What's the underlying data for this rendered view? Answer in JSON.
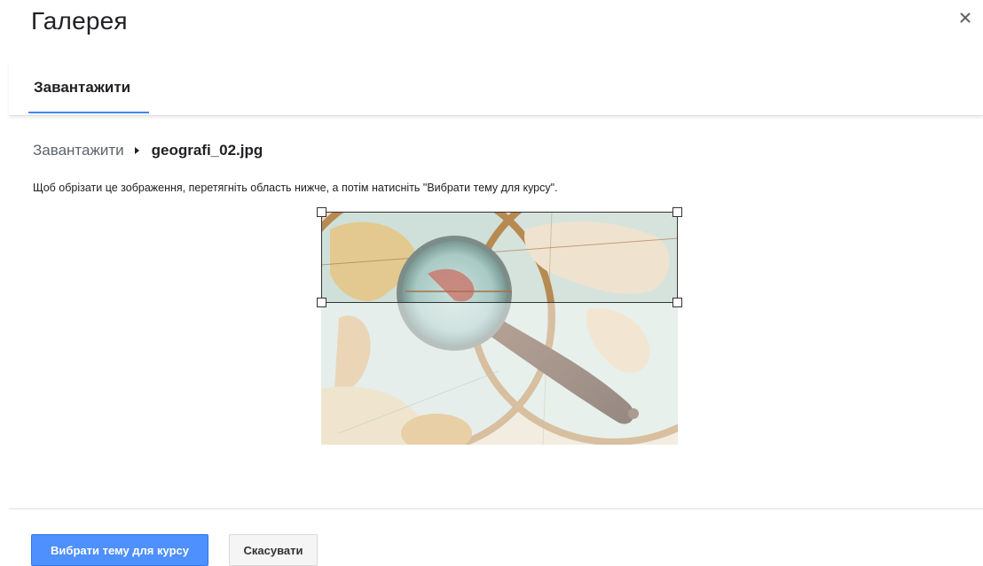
{
  "dialog": {
    "title": "Галерея",
    "close_icon": "close-icon"
  },
  "tabs": [
    {
      "label": "Завантажити",
      "active": true
    }
  ],
  "breadcrumb": {
    "parent": "Завантажити",
    "separator_icon": "triangle-right-icon",
    "current": "geografi_02.jpg"
  },
  "instructions": "Щоб обрізати це зображення, перетягніть область нижче, а потім натисніть \"Вибрати тему для курсу\".",
  "footer": {
    "primary_label": "Вибрати тему для курсу",
    "cancel_label": "Скасувати"
  },
  "colors": {
    "accent": "#4285f4",
    "primary_button": "#4d90fe"
  }
}
